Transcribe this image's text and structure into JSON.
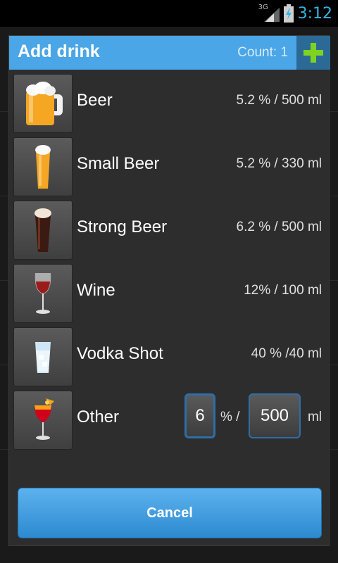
{
  "status_bar": {
    "network": "3G",
    "time": "3:12"
  },
  "dialog": {
    "title": "Add drink",
    "count_label": "Count: 1",
    "add_icon": "plus-icon",
    "drinks": [
      {
        "name": "Beer",
        "spec": "5.2 % / 500 ml",
        "icon": "beer-mug-icon"
      },
      {
        "name": "Small Beer",
        "spec": "5.2 % / 330 ml",
        "icon": "beer-glass-icon"
      },
      {
        "name": "Strong Beer",
        "spec": "6.2 % / 500 ml",
        "icon": "stout-glass-icon"
      },
      {
        "name": "Wine",
        "spec": "12% / 100 ml",
        "icon": "wine-glass-icon"
      },
      {
        "name": "Vodka Shot",
        "spec": "40 % /40 ml",
        "icon": "shot-glass-icon"
      }
    ],
    "other": {
      "name": "Other",
      "icon": "cocktail-icon",
      "percent_value": "6",
      "percent_label": "% /",
      "volume_value": "500",
      "volume_label": "ml"
    },
    "cancel_label": "Cancel"
  },
  "colors": {
    "accent": "#33b5e5",
    "header": "#4aa6e6",
    "add_button": "#2b6a96",
    "plus": "#7ed321"
  }
}
